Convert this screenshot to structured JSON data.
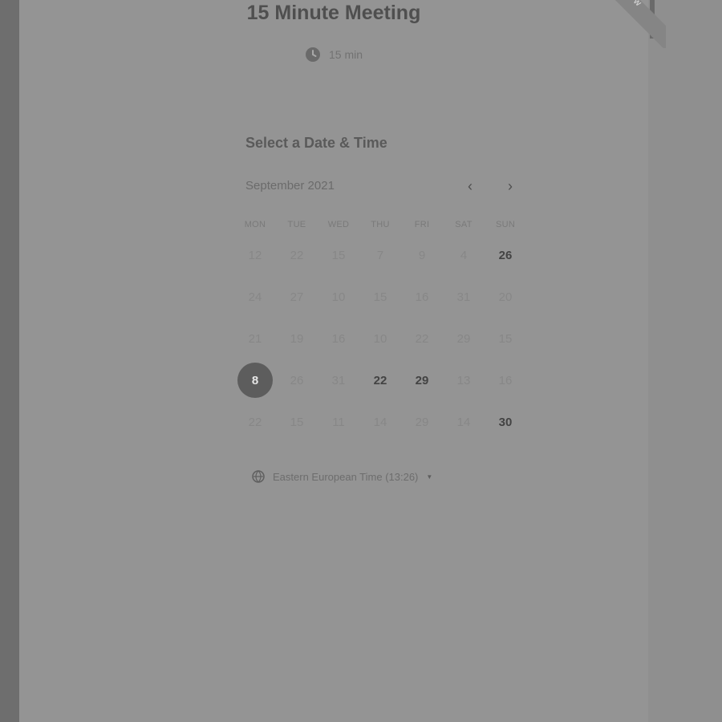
{
  "event": {
    "title": "15 Minute Meeting",
    "duration": "15 min"
  },
  "ribbon": {
    "label": "W"
  },
  "calendar": {
    "heading": "Select a Date & Time",
    "month_label": "September 2021",
    "weekdays": [
      "MON",
      "TUE",
      "WED",
      "THU",
      "FRI",
      "SAT",
      "SUN"
    ],
    "weeks": [
      [
        "12",
        "22",
        "15",
        "7",
        "9",
        "4",
        "26"
      ],
      [
        "24",
        "27",
        "10",
        "15",
        "16",
        "31",
        "20"
      ],
      [
        "21",
        "19",
        "16",
        "10",
        "22",
        "29",
        "15"
      ],
      [
        "8",
        "26",
        "31",
        "22",
        "29",
        "13",
        "16"
      ],
      [
        "22",
        "15",
        "11",
        "14",
        "29",
        "14",
        "30"
      ]
    ],
    "available": [
      "26",
      "22",
      "29",
      "30"
    ],
    "selected": "8"
  },
  "timezone": {
    "label": "Eastern European Time (13:26)"
  }
}
